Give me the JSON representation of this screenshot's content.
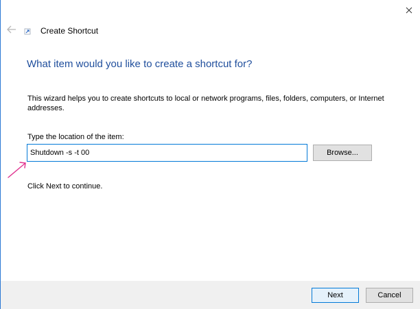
{
  "window": {
    "title": "Create Shortcut"
  },
  "icons": {
    "close": "close-icon",
    "back": "back-arrow-icon",
    "title": "shortcut-icon",
    "annotation": "annotation-arrow-icon"
  },
  "colors": {
    "accent": "#0078d7",
    "heading": "#1f4e9c",
    "annotation": "#e0338f"
  },
  "main": {
    "heading": "What item would you like to create a shortcut for?",
    "description": "This wizard helps you to create shortcuts to local or network programs, files, folders, computers, or Internet addresses.",
    "location_label": "Type the location of the item:",
    "location_value": "Shutdown -s -t 00",
    "browse_label": "Browse...",
    "continue_text": "Click Next to continue."
  },
  "footer": {
    "next_label": "Next",
    "cancel_label": "Cancel"
  }
}
